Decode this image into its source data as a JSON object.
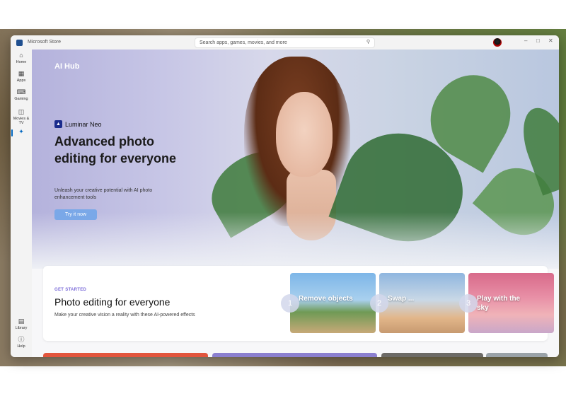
{
  "window": {
    "title": "Microsoft Store"
  },
  "search": {
    "placeholder": "Search apps, games, movies, and more"
  },
  "sidebar": {
    "items": [
      {
        "label": "Home",
        "icon": "home-icon"
      },
      {
        "label": "Apps",
        "icon": "apps-icon"
      },
      {
        "label": "Gaming",
        "icon": "gaming-icon"
      },
      {
        "label": "Movies & TV",
        "icon": "movies-icon"
      },
      {
        "label": "",
        "icon": "ai-hub-icon"
      }
    ],
    "bottom": [
      {
        "label": "Library",
        "icon": "library-icon"
      },
      {
        "label": "Help",
        "icon": "help-icon"
      }
    ]
  },
  "hero": {
    "section_label": "AI Hub",
    "brand": "Luminar Neo",
    "title": "Advanced photo editing for everyone",
    "description": "Unleash your creative potential with AI photo enhancement tools",
    "cta": "Try it now"
  },
  "card": {
    "kicker": "GET STARTED",
    "title": "Photo editing for everyone",
    "description": "Make your creative vision a reality with these AI-powered effects",
    "tiles": [
      {
        "number": "1",
        "label": "Remove objects"
      },
      {
        "number": "2",
        "label": "Swap ..."
      },
      {
        "number": "3",
        "label": "Play with the sky"
      }
    ]
  },
  "colors": {
    "accent": "#0067c0",
    "cta": "#7aa8e8",
    "kicker": "#7a6ad8"
  }
}
